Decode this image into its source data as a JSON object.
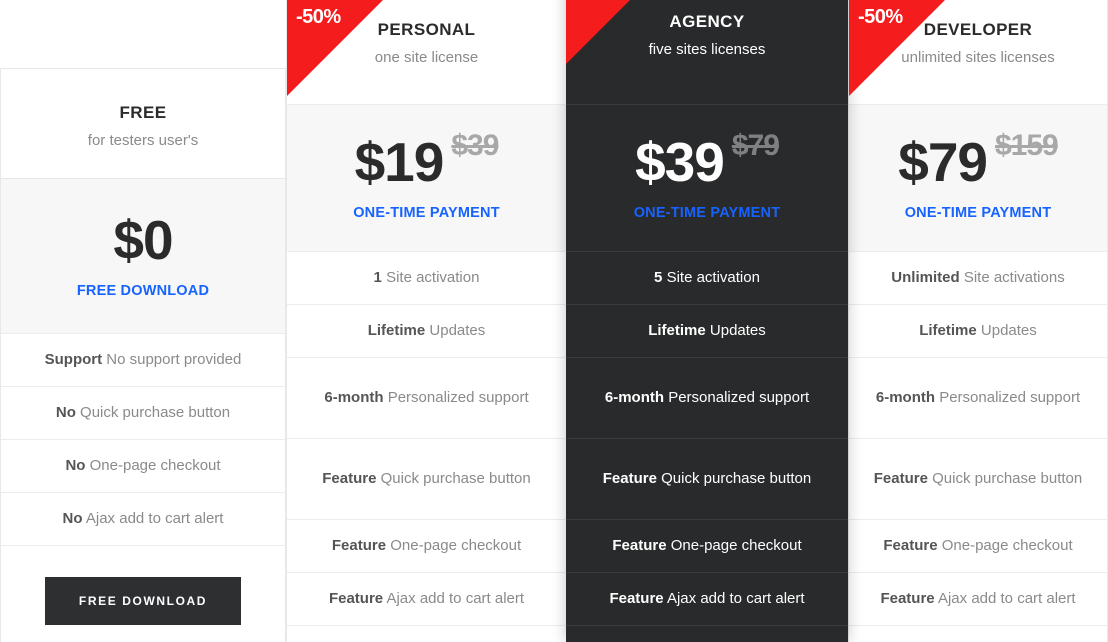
{
  "ribbon": {
    "label": "-50%",
    "color": "#f41c1c"
  },
  "accent": {
    "blue": "#1763ff",
    "dark": "#282a2b"
  },
  "columns": [
    {
      "id": "free",
      "name": "FREE",
      "subtitle": "for testers user's",
      "price_now": "$0",
      "price_old": "",
      "price_note": "FREE DOWNLOAD",
      "has_ribbon": false,
      "features": [
        {
          "bold": "Support",
          "text": "No support provided"
        },
        {
          "bold": "No",
          "text": "Quick purchase button"
        },
        {
          "bold": "No",
          "text": "One-page checkout"
        },
        {
          "bold": "No",
          "text": "Ajax add to cart alert"
        }
      ],
      "cta": "FREE DOWNLOAD"
    },
    {
      "id": "personal",
      "name": "PERSONAL",
      "subtitle": "one site license",
      "price_now": "$19",
      "price_old": "$39",
      "price_note": "ONE-TIME PAYMENT",
      "has_ribbon": true,
      "features": [
        {
          "bold": "1",
          "text": "Site activation"
        },
        {
          "bold": "Lifetime",
          "text": "Updates"
        },
        {
          "bold": "6-month",
          "text": "Personalized support"
        },
        {
          "bold": "Feature",
          "text": "Quick purchase button"
        },
        {
          "bold": "Feature",
          "text": "One-page checkout"
        },
        {
          "bold": "Feature",
          "text": "Ajax add to cart alert"
        }
      ]
    },
    {
      "id": "agency",
      "name": "AGENCY",
      "subtitle": "five sites licenses",
      "price_now": "$39",
      "price_old": "$79",
      "price_note": "ONE-TIME PAYMENT",
      "has_ribbon": true,
      "features": [
        {
          "bold": "5",
          "text": "Site activation"
        },
        {
          "bold": "Lifetime",
          "text": "Updates"
        },
        {
          "bold": "6-month",
          "text": "Personalized support"
        },
        {
          "bold": "Feature",
          "text": "Quick purchase button"
        },
        {
          "bold": "Feature",
          "text": "One-page checkout"
        },
        {
          "bold": "Feature",
          "text": "Ajax add to cart alert"
        }
      ]
    },
    {
      "id": "developer",
      "name": "DEVELOPER",
      "subtitle": "unlimited sites licenses",
      "price_now": "$79",
      "price_old": "$159",
      "price_note": "ONE-TIME PAYMENT",
      "has_ribbon": true,
      "features": [
        {
          "bold": "Unlimited",
          "text": "Site activations"
        },
        {
          "bold": "Lifetime",
          "text": "Updates"
        },
        {
          "bold": "6-month",
          "text": "Personalized support"
        },
        {
          "bold": "Feature",
          "text": "Quick purchase button"
        },
        {
          "bold": "Feature",
          "text": "One-page checkout"
        },
        {
          "bold": "Feature",
          "text": "Ajax add to cart alert"
        }
      ]
    }
  ]
}
